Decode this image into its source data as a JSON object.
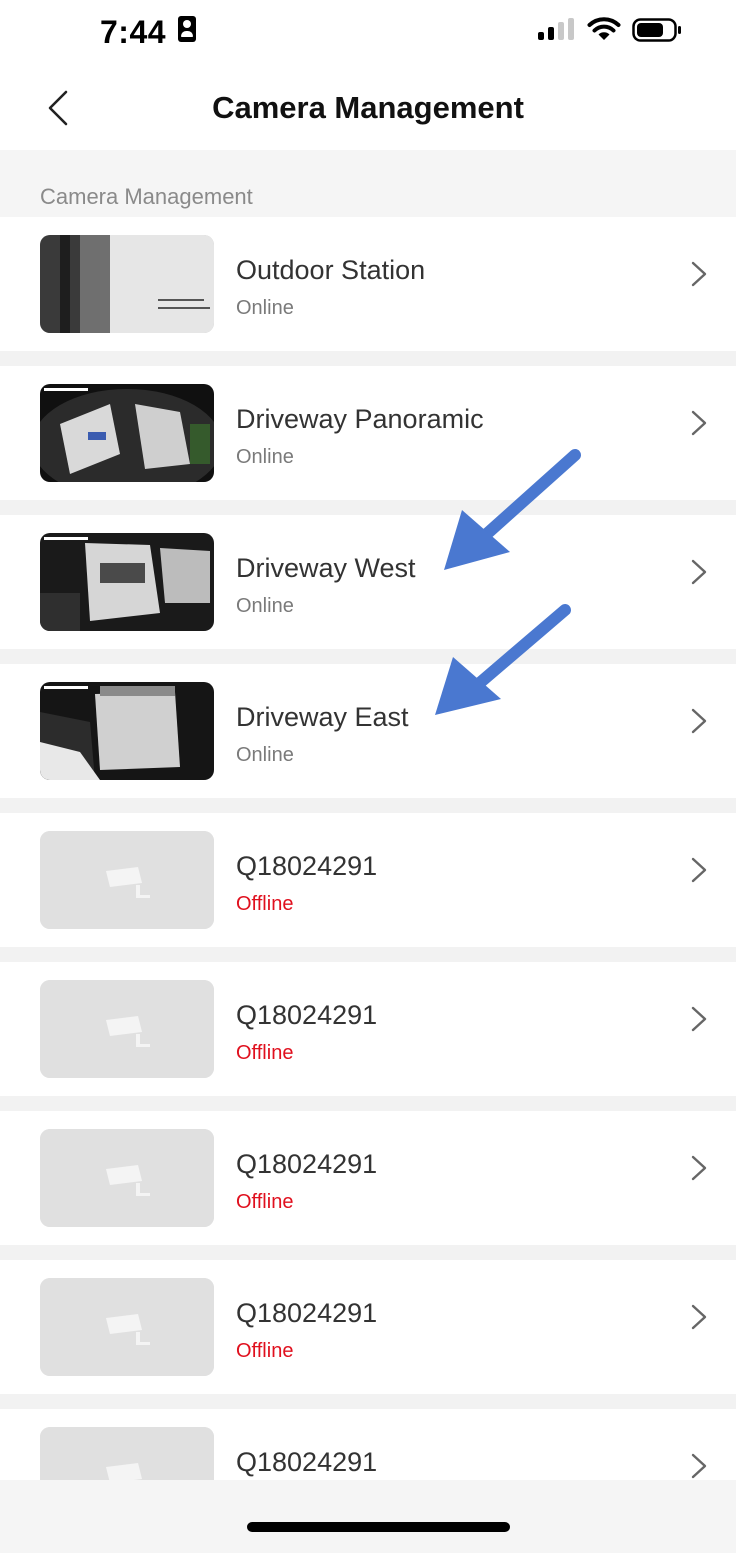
{
  "status_bar": {
    "time": "7:44",
    "icons": [
      "person-badge-icon",
      "signal-icon",
      "wifi-icon",
      "battery-icon"
    ]
  },
  "nav": {
    "title": "Camera Management",
    "back_icon": "chevron-left-icon"
  },
  "section": {
    "label": "Camera Management"
  },
  "cameras": [
    {
      "name": "Outdoor Station",
      "status": "Online",
      "online": true,
      "thumb": "outdoor-station-snapshot"
    },
    {
      "name": "Driveway Panoramic",
      "status": "Online",
      "online": true,
      "thumb": "driveway-panoramic-snapshot"
    },
    {
      "name": "Driveway West",
      "status": "Online",
      "online": true,
      "thumb": "driveway-west-snapshot"
    },
    {
      "name": "Driveway East",
      "status": "Online",
      "online": true,
      "thumb": "driveway-east-snapshot"
    },
    {
      "name": "Q18024291",
      "status": "Offline",
      "online": false,
      "thumb": "camera-placeholder-icon"
    },
    {
      "name": "Q18024291",
      "status": "Offline",
      "online": false,
      "thumb": "camera-placeholder-icon"
    },
    {
      "name": "Q18024291",
      "status": "Offline",
      "online": false,
      "thumb": "camera-placeholder-icon"
    },
    {
      "name": "Q18024291",
      "status": "Offline",
      "online": false,
      "thumb": "camera-placeholder-icon"
    },
    {
      "name": "Q18024291",
      "status": "",
      "online": false,
      "thumb": "camera-placeholder-icon"
    }
  ],
  "colors": {
    "offline": "#e0101e",
    "online_text": "#7a7a7a",
    "separator": "#f2f2f2",
    "annotation_arrow": "#4a78d0"
  }
}
